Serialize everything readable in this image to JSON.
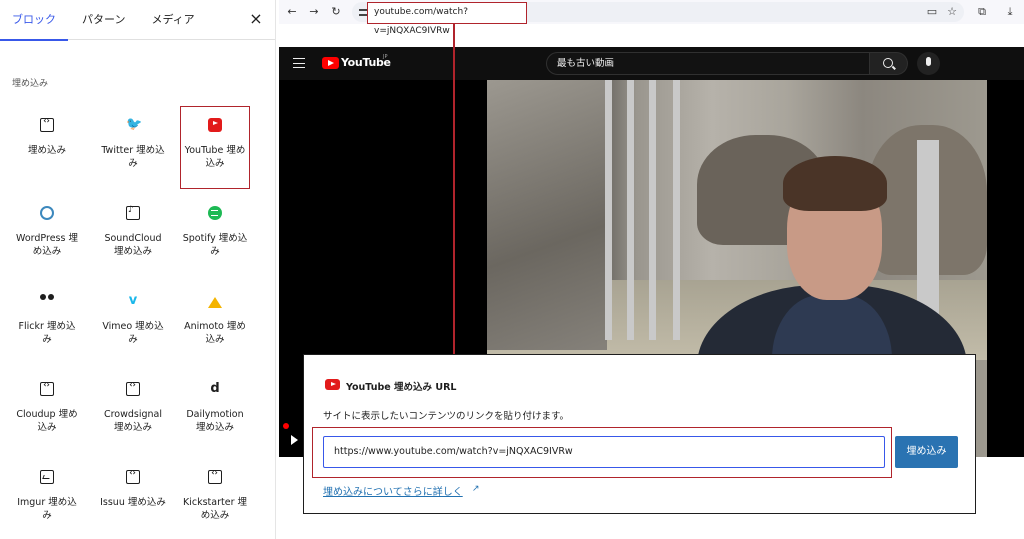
{
  "inserter": {
    "tabs": [
      {
        "label": "ブロック"
      },
      {
        "label": "パターン"
      },
      {
        "label": "メディア"
      }
    ],
    "close_label": "×",
    "category": "埋め込み",
    "blocks": [
      {
        "label": "埋め込み",
        "icon": "embed-icon"
      },
      {
        "label": "Twitter 埋め込み",
        "icon": "twitter-icon"
      },
      {
        "label": "YouTube 埋め込み",
        "icon": "youtube-icon",
        "highlighted": true
      },
      {
        "label": "WordPress 埋め込み",
        "icon": "wordpress-icon"
      },
      {
        "label": "SoundCloud 埋め込み",
        "icon": "soundcloud-icon"
      },
      {
        "label": "Spotify 埋め込み",
        "icon": "spotify-icon"
      },
      {
        "label": "Flickr 埋め込み",
        "icon": "flickr-icon"
      },
      {
        "label": "Vimeo 埋め込み",
        "icon": "vimeo-icon"
      },
      {
        "label": "Animoto 埋め込み",
        "icon": "animoto-icon"
      },
      {
        "label": "Cloudup 埋め込み",
        "icon": "embed-icon"
      },
      {
        "label": "Crowdsignal 埋め込み",
        "icon": "embed-icon"
      },
      {
        "label": "Dailymotion 埋め込み",
        "icon": "dailymotion-icon"
      },
      {
        "label": "Imgur 埋め込み",
        "icon": "imgur-icon"
      },
      {
        "label": "Issuu 埋め込み",
        "icon": "embed-icon"
      },
      {
        "label": "Kickstarter 埋め込み",
        "icon": "embed-icon"
      }
    ]
  },
  "browser": {
    "url": "youtube.com/watch?v=jNQXAC9IVRw",
    "youtube": {
      "logo_text": "YouTube",
      "region": "JP",
      "search_value": "最も古い動画"
    }
  },
  "embed": {
    "title": "YouTube 埋め込み URL",
    "instructions": "サイトに表示したいコンテンツのリンクを貼り付けます。",
    "input_value": "https://www.youtube.com/watch?v=jNQXAC9IVRw",
    "button_label": "埋め込み",
    "learn_more": "埋め込みについてさらに詳しく",
    "external_glyph": "↗"
  },
  "colors": {
    "accent": "#3858e9",
    "highlight": "#b0242c",
    "youtube_red": "#ff0000",
    "button": "#2a73b2"
  }
}
